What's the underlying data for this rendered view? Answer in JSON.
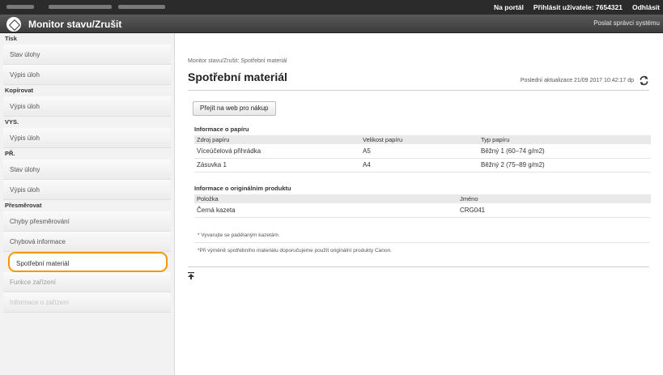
{
  "topbar": {
    "portal_link": "Na portál",
    "user_label": "Přihlásit uživatele: 7654321",
    "logout_link": "Odhlásit"
  },
  "header": {
    "title": "Monitor stavu/Zrušit",
    "admin_link": "Poslat správci systému"
  },
  "sidebar": {
    "sections": [
      {
        "title": "Tisk",
        "items": [
          "Stav úlohy",
          "Výpis úloh"
        ]
      },
      {
        "title": "Kopírovat",
        "items": [
          "Výpis úloh"
        ]
      },
      {
        "title": "VYS.",
        "items": [
          "Výpis úloh"
        ]
      },
      {
        "title": "PŘ.",
        "items": [
          "Stav úlohy",
          "Výpis úloh"
        ]
      },
      {
        "title": "Přesměrovat",
        "items": [
          "Chyby přesměrování",
          "Chybová informace",
          "Spotřební materiál",
          "Funkce zařízení",
          "Informace o zařízení"
        ]
      }
    ],
    "active_item": "Spotřební materiál"
  },
  "main": {
    "breadcrumb": "Monitor stavu/Zrušit: Spotřební materiál",
    "title": "Spotřební materiál",
    "last_updated": "Poslední aktualizace 21/09 2017 10:42:17 dp",
    "buy_button": "Přejít na web pro nákup",
    "paper": {
      "title": "Informace o papíru",
      "headers": [
        "Zdroj papíru",
        "Velikost papíru",
        "Typ papíru"
      ],
      "rows": [
        [
          "Víceúčelová přihrádka",
          "A5",
          "Běžný 1 (60–74 g/m2)"
        ],
        [
          "Zásuvka 1",
          "A4",
          "Běžný 2 (75–89 g/m2)"
        ]
      ]
    },
    "product": {
      "title": "Informace o originálním produktu",
      "headers": [
        "Položka",
        "Jméno"
      ],
      "rows": [
        [
          "Černá kazeta",
          "CRG041"
        ]
      ]
    },
    "note1": "* Vyvarujte se padělaným kazetám.",
    "note2": "*Při výměně spotřebního materiálu doporučujeme použít originální produkty Canon."
  },
  "colors": {
    "accent": "#f39800",
    "topbar": "#2b2b2b",
    "header": "#4a4a4a"
  }
}
